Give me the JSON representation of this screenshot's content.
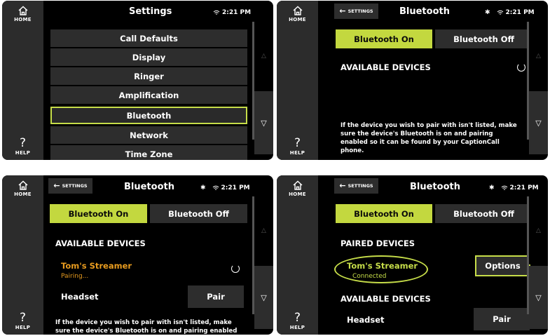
{
  "nav": {
    "home_label": "HOME",
    "help_label": "?",
    "help_sub": "HELP"
  },
  "status": {
    "time": "2:21 PM",
    "bluetooth_glyph": "✱"
  },
  "settings_screen": {
    "title": "Settings",
    "items": [
      "Call Defaults",
      "Display",
      "Ringer",
      "Amplification",
      "Bluetooth",
      "Network",
      "Time Zone"
    ],
    "selected": "Bluetooth"
  },
  "bluetooth": {
    "title": "Bluetooth",
    "back_label": "SETTINGS",
    "on_label": "Bluetooth On",
    "off_label": "Bluetooth Off",
    "available_heading": "AVAILABLE DEVICES",
    "paired_heading": "PAIRED DEVICES",
    "help_text_full": "If the device you wish to pair with isn't listed, make sure the device's Bluetooth is on and pairing enabled so it can be found by your CaptionCall phone.",
    "help_text_partial": "If the device you wish to pair with isn't listed, make sure the device's Bluetooth is on and pairing enabled",
    "devices": {
      "streamer_name": "Tom's Streamer",
      "streamer_pairing": "Pairing...",
      "streamer_connected": "Connected",
      "headset_name": "Headset",
      "pair_label": "Pair",
      "options_label": "Options"
    }
  },
  "colors": {
    "accent": "#c6dd49",
    "toggle_on": "#c3d83f",
    "pairing": "#e79b1f",
    "button_bg": "#2d2d2d",
    "sidebar_bg": "#2c2c2c"
  }
}
